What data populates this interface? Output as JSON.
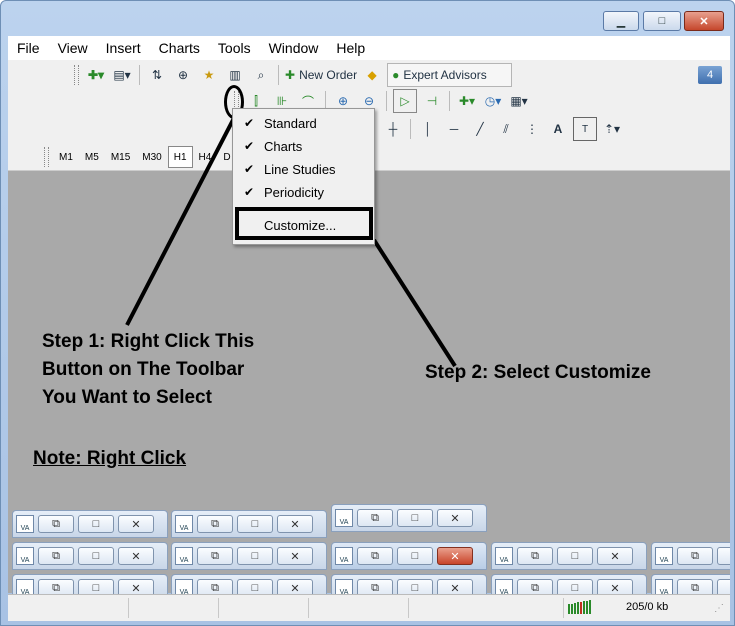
{
  "window": {
    "controls": {
      "minimize": "▁",
      "maximize": "□",
      "close": "✕"
    }
  },
  "menubar": {
    "items": [
      "File",
      "View",
      "Insert",
      "Charts",
      "Tools",
      "Window",
      "Help"
    ]
  },
  "toolbar_standard": {
    "new_order_label": "New Order",
    "expert_advisors_label": "Expert Advisors"
  },
  "notification_badge": "4",
  "toolbar_periodicity": {
    "timeframes": [
      "M1",
      "M5",
      "M15",
      "M30",
      "H1",
      "H4",
      "D"
    ],
    "active": "H1"
  },
  "context_menu": {
    "items": [
      {
        "label": "Standard",
        "checked": true
      },
      {
        "label": "Charts",
        "checked": true
      },
      {
        "label": "Line Studies",
        "checked": true
      },
      {
        "label": "Periodicity",
        "checked": true
      },
      {
        "label": "Customize...",
        "checked": false
      }
    ]
  },
  "annotations": {
    "step1": [
      "Step 1: Right Click This",
      "Button on The Toolbar",
      "You Want to Select"
    ],
    "step2": "Step 2: Select Customize",
    "note": "Note: Right Click"
  },
  "status_bar": {
    "traffic": "205/0 kb"
  }
}
